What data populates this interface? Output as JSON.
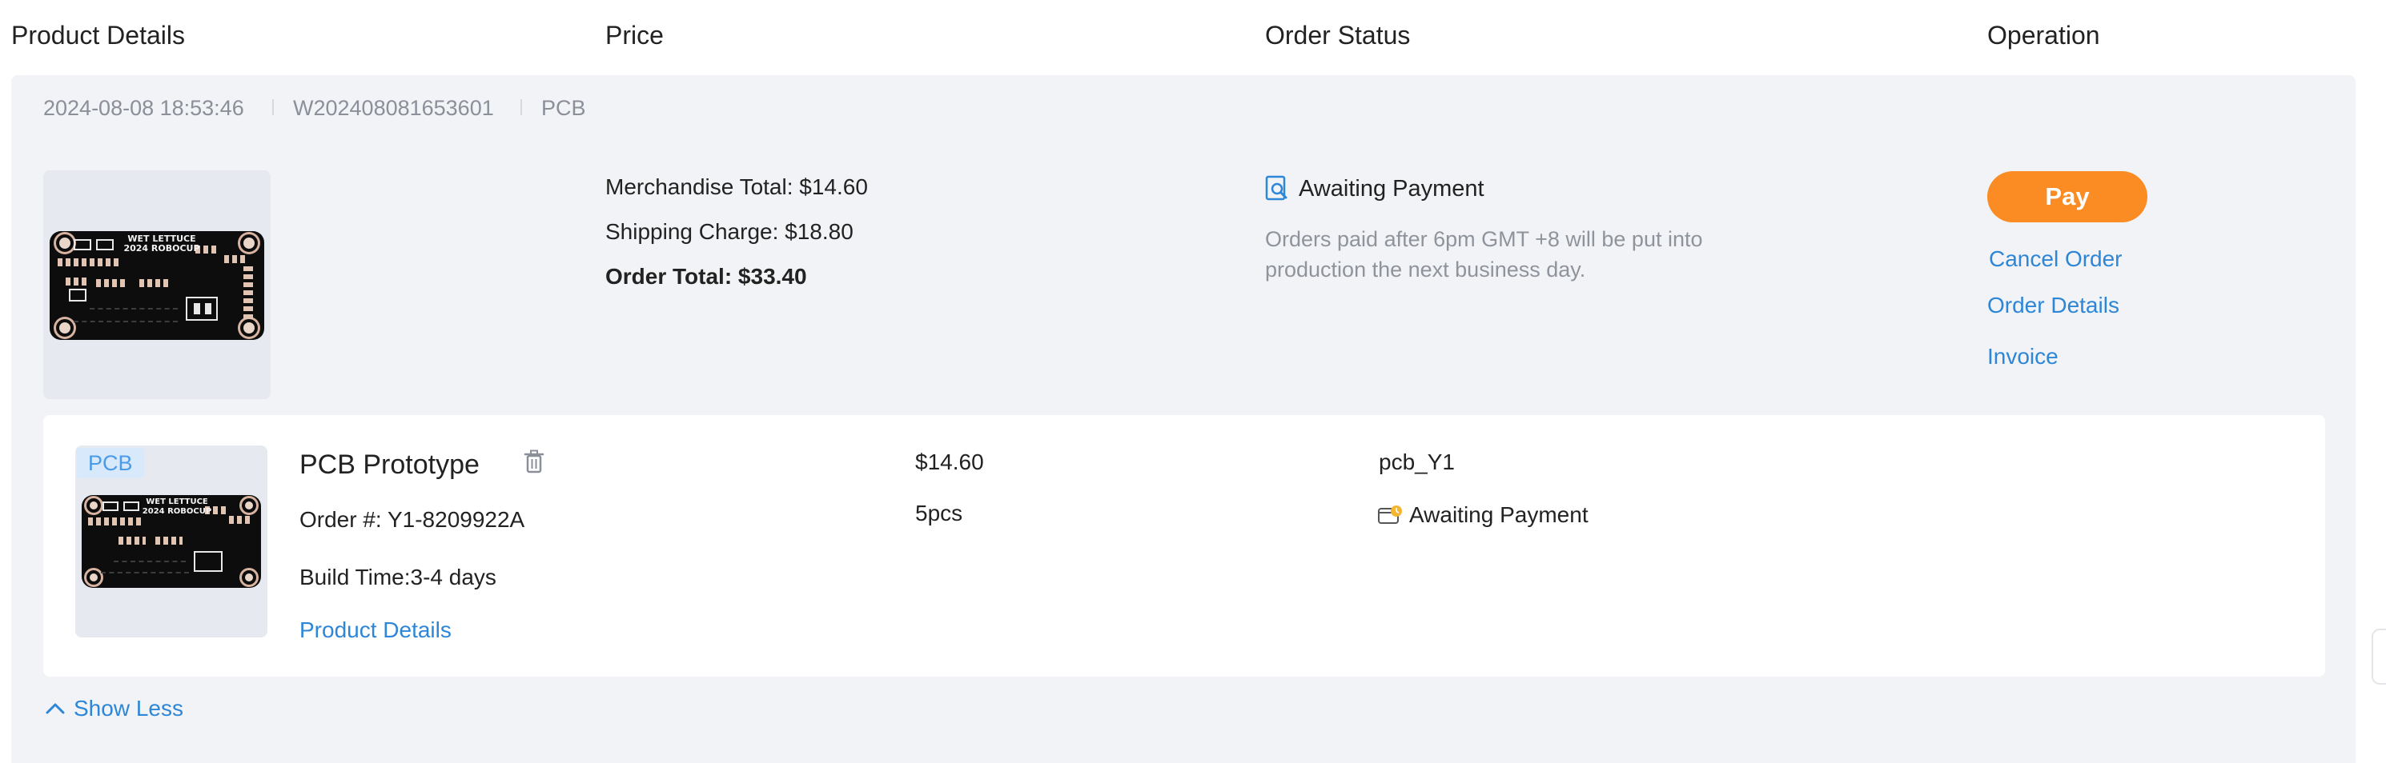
{
  "header": {
    "col_product": "Product Details",
    "col_price": "Price",
    "col_status": "Order Status",
    "col_operation": "Operation"
  },
  "order": {
    "date": "2024-08-08 18:53:46",
    "order_no": "W202408081653601",
    "category": "PCB",
    "pcb_label": "WET LETTUCE\n2024 ROBOCUP",
    "merchandise_total": "Merchandise Total: $14.60",
    "shipping_charge": "Shipping Charge: $18.80",
    "order_total": "Order Total: $33.40",
    "status": "Awaiting Payment",
    "status_note": "Orders paid after 6pm GMT +8 will be put into production the next business day.",
    "actions": {
      "pay": "Pay",
      "cancel": "Cancel Order",
      "details": "Order Details",
      "invoice": "Invoice"
    }
  },
  "item": {
    "tag": "PCB",
    "title": "PCB Prototype",
    "order_no": "Order #: Y1-8209922A",
    "build_time": "Build Time:3-4 days",
    "details_link": "Product Details",
    "price": "$14.60",
    "quantity": "5pcs",
    "file_name": "pcb_Y1",
    "status": "Awaiting Payment"
  },
  "footer": {
    "show_less": "Show Less"
  },
  "colors": {
    "accent_orange": "#fb8c23",
    "link_blue": "#2d86d6",
    "card_bg": "#f1f3f6",
    "status_icon_yellow": "#f5b52e"
  },
  "icons": {
    "status_icon": "search-document-icon",
    "delete_icon": "trash-icon",
    "item_status_icon": "wallet-clock-icon",
    "collapse_icon": "chevron-up-icon"
  }
}
